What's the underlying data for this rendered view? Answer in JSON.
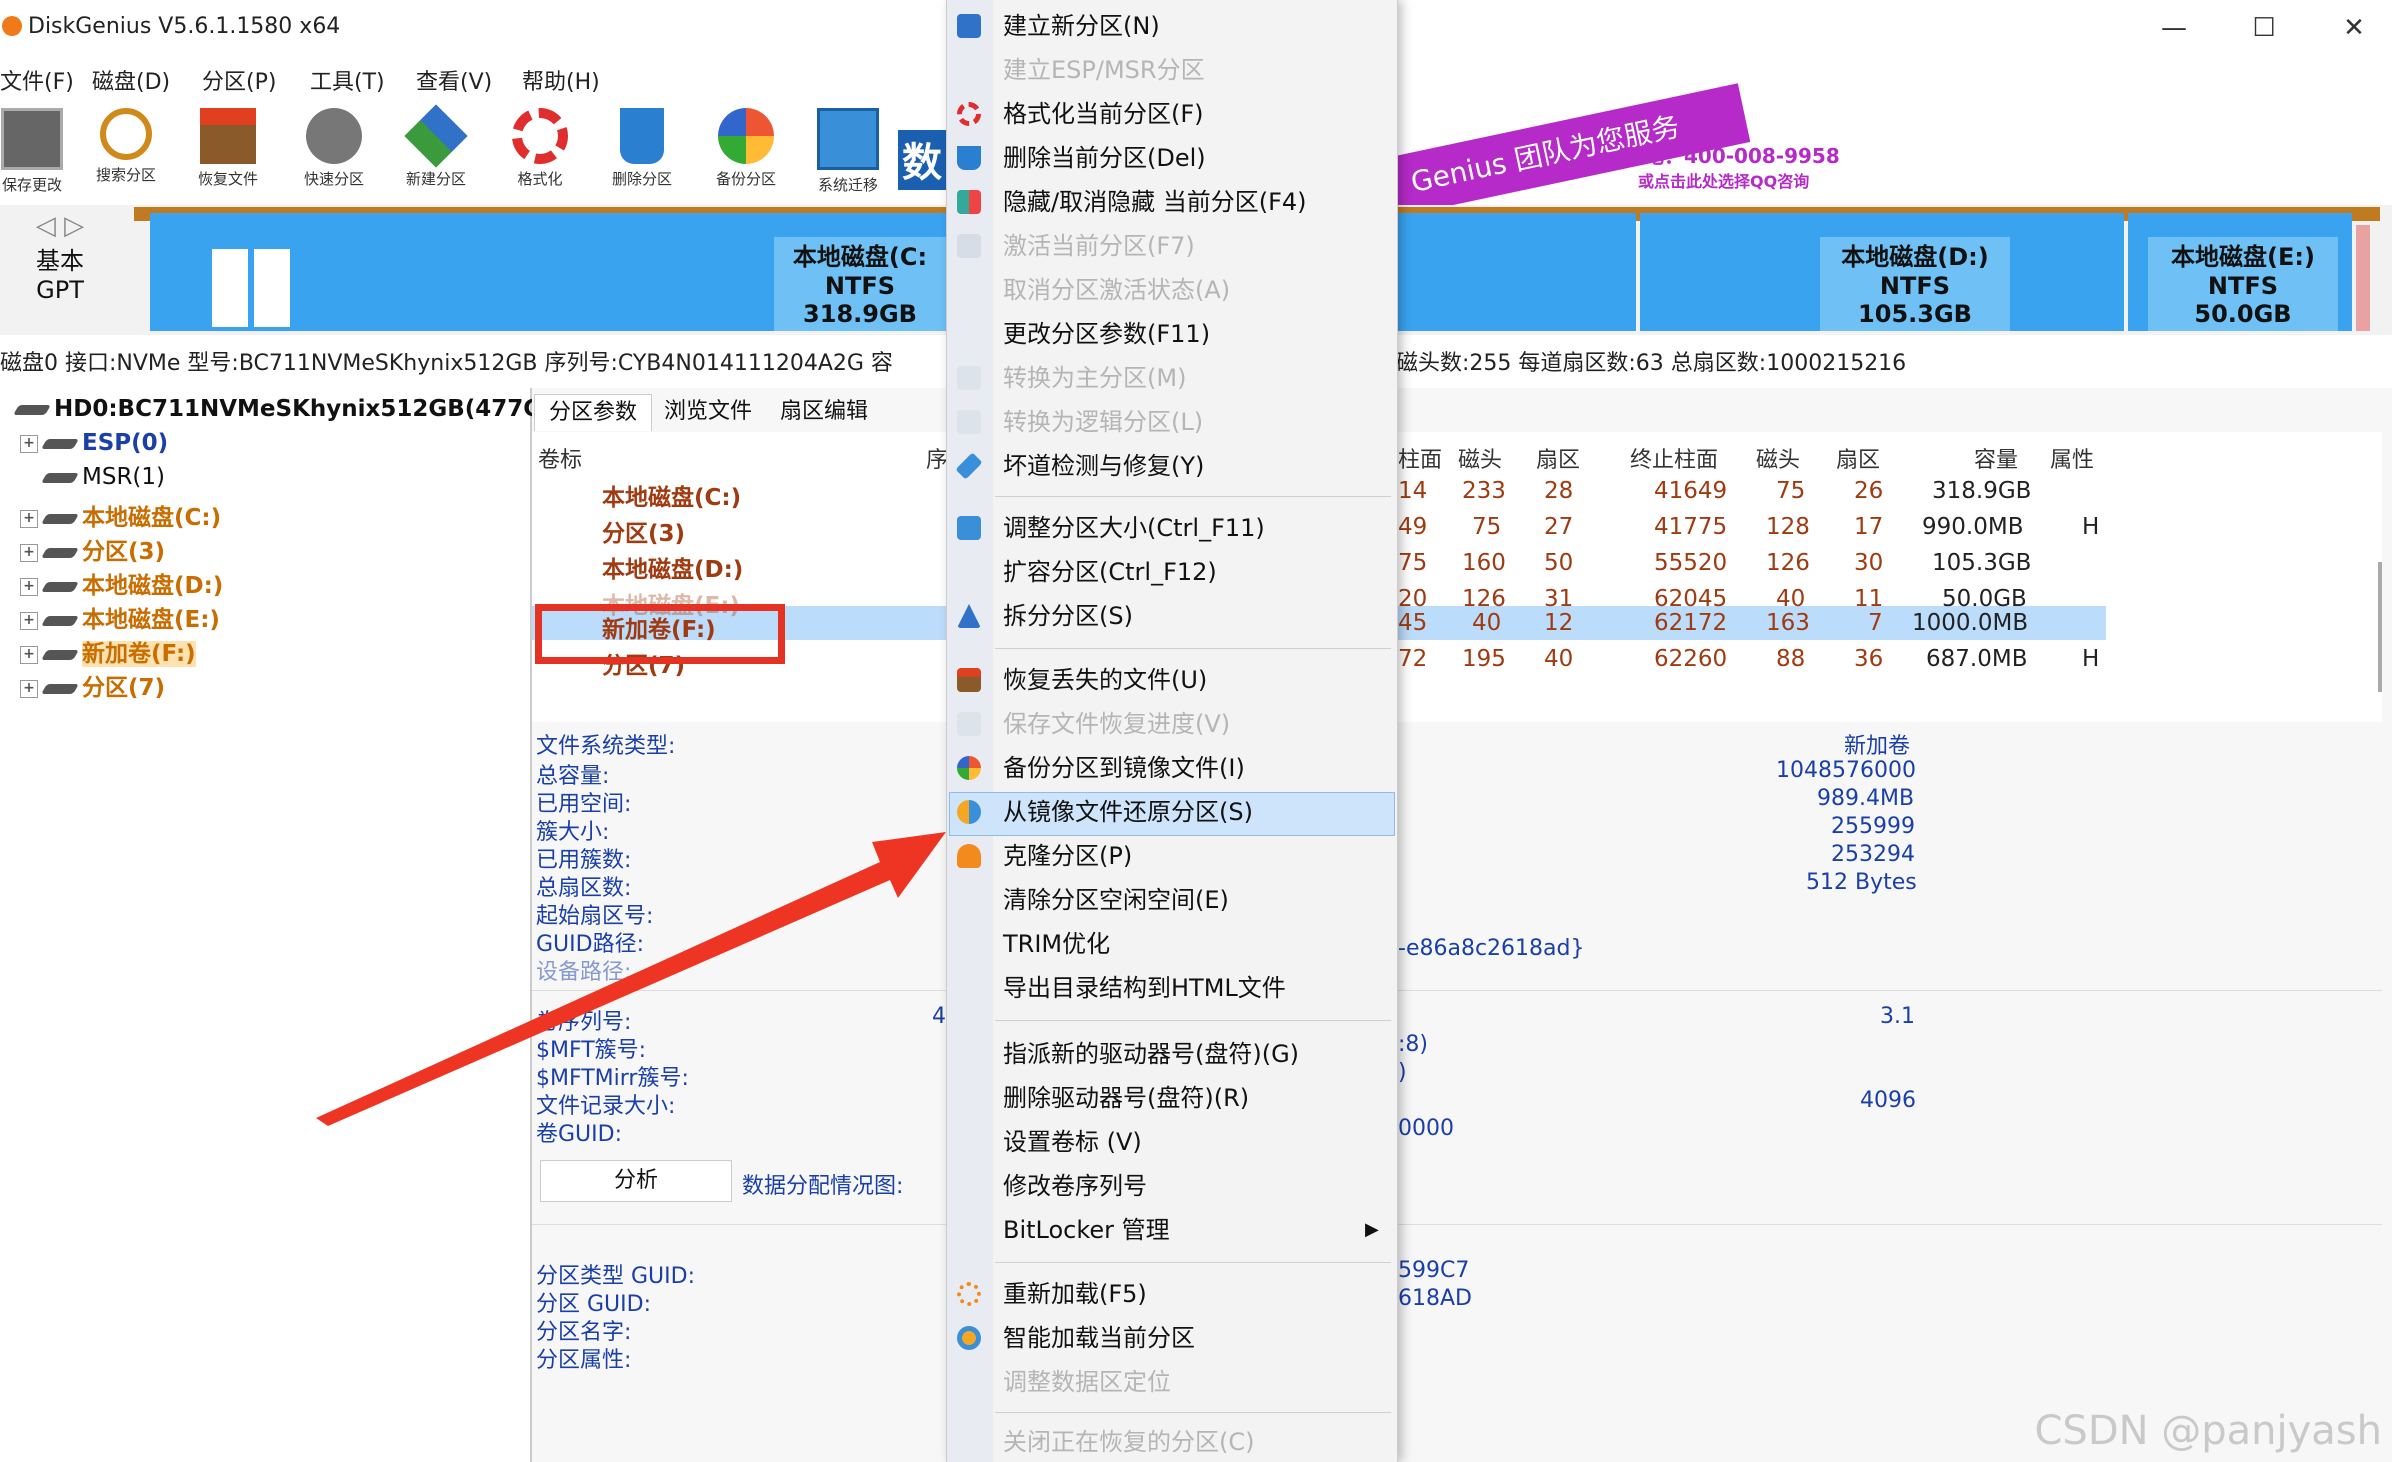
{
  "window": {
    "title": "DiskGenius V5.6.1.1580 x64",
    "minimize": "—",
    "maximize": "☐",
    "close": "✕"
  },
  "menubar": [
    "文件(F)",
    "磁盘(D)",
    "分区(P)",
    "工具(T)",
    "查看(V)",
    "帮助(H)"
  ],
  "toolbar": [
    {
      "label": "保存更改",
      "icon": "save-icon"
    },
    {
      "label": "搜索分区",
      "icon": "search-icon"
    },
    {
      "label": "恢复文件",
      "icon": "recover-icon"
    },
    {
      "label": "快速分区",
      "icon": "quick-partition-icon"
    },
    {
      "label": "新建分区",
      "icon": "new-partition-icon"
    },
    {
      "label": "格式化",
      "icon": "format-icon"
    },
    {
      "label": "删除分区",
      "icon": "delete-icon"
    },
    {
      "label": "备份分区",
      "icon": "backup-icon"
    },
    {
      "label": "系统迁移",
      "icon": "migrate-icon"
    }
  ],
  "banner": {
    "text1": "数",
    "slogan": "Genius 团队为您服务",
    "phone": "致电：400-008-9958",
    "qq": "或点击此处选择QQ咨询"
  },
  "disk_strip": {
    "type_line1": "基本",
    "type_line2": "GPT",
    "partitions": [
      {
        "name": "本地磁盘(C:",
        "fs": "NTFS",
        "size": "318.9GB"
      },
      {
        "name": "本地磁盘(D:)",
        "fs": "NTFS",
        "size": "105.3GB"
      },
      {
        "name": "本地磁盘(E:)",
        "fs": "NTFS",
        "size": "50.0GB"
      }
    ]
  },
  "info_line": {
    "left": "磁盘0 接口:NVMe  型号:BC711NVMeSKhynix512GB  序列号:CYB4N014111204A2G  容",
    "right": "磁头数:255  每道扇区数:63  总扇区数:1000215216"
  },
  "tree": {
    "root": "HD0:BC711NVMeSKhynix512GB(477GB",
    "items": [
      "ESP(0)",
      "MSR(1)",
      "本地磁盘(C:)",
      "分区(3)",
      "本地磁盘(D:)",
      "本地磁盘(E:)",
      "新加卷(F:)",
      "分区(7)"
    ]
  },
  "tabs": [
    "分区参数",
    "浏览文件",
    "扇区编辑"
  ],
  "table": {
    "col_label": "卷标",
    "col_seq": "序",
    "headers_right": [
      "柱面",
      "磁头",
      "扇区",
      "终止柱面",
      "磁头",
      "扇区",
      "容量",
      "属性"
    ],
    "rows": [
      {
        "label": "本地磁盘(C:)",
        "c1": "14",
        "h1": "233",
        "s1": "28",
        "ec": "41649",
        "h2": "75",
        "s2": "26",
        "cap": "318.9GB",
        "attr": ""
      },
      {
        "label": "分区(3)",
        "c1": "49",
        "h1": "75",
        "s1": "27",
        "ec": "41775",
        "h2": "128",
        "s2": "17",
        "cap": "990.0MB",
        "attr": "H"
      },
      {
        "label": "本地磁盘(D:)",
        "c1": "75",
        "h1": "160",
        "s1": "50",
        "ec": "55520",
        "h2": "126",
        "s2": "30",
        "cap": "105.3GB",
        "attr": ""
      },
      {
        "label": "本地磁盘(E:)",
        "c1": "20",
        "h1": "126",
        "s1": "31",
        "ec": "62045",
        "h2": "40",
        "s2": "11",
        "cap": "50.0GB",
        "attr": ""
      },
      {
        "label": "新加卷(F:)",
        "c1": "45",
        "h1": "40",
        "s1": "12",
        "ec": "62172",
        "h2": "163",
        "s2": "7",
        "cap": "1000.0MB",
        "attr": ""
      },
      {
        "label": "分区(7)",
        "c1": "72",
        "h1": "195",
        "s1": "40",
        "ec": "62260",
        "h2": "88",
        "s2": "36",
        "cap": "687.0MB",
        "attr": "H"
      }
    ]
  },
  "fs_info": {
    "fs_type_label": "文件系统类型:",
    "fs_type_value": "新加卷",
    "labels": [
      "总容量:",
      "已用空间:",
      "簇大小:",
      "已用簇数:",
      "总扇区数:",
      "起始扇区号:",
      "GUID路径:",
      "设备路径:"
    ],
    "values": [
      "1048576000",
      "989.4MB",
      "255999",
      "253294",
      "512 Bytes"
    ],
    "guid_path_tail": "-e86a8c2618ad}",
    "labels2": [
      "卷序列号:",
      "$MFT簇号:",
      "$MFTMirr簇号:",
      "文件记录大小:",
      "卷GUID:"
    ],
    "serial_fragment": "4",
    "ntfs_version": "3.1",
    "mft_fragment": ":8)",
    "mftmirr_fragment": ")",
    "record_size": "4096",
    "vol_guid_tail": "0000",
    "analyze_button": "分析",
    "alloc_label": "数据分配情况图:",
    "labels3": [
      "分区类型 GUID:",
      "分区 GUID:",
      "分区名字:",
      "分区属性:"
    ],
    "type_guid_tail": "599C7",
    "part_guid_tail": "618AD"
  },
  "context_menu": [
    {
      "label": "建立新分区(N)",
      "enabled": true,
      "icon": "new-partition-icon"
    },
    {
      "label": "建立ESP/MSR分区",
      "enabled": false
    },
    {
      "label": "格式化当前分区(F)",
      "enabled": true,
      "icon": "format-icon"
    },
    {
      "label": "删除当前分区(Del)",
      "enabled": true,
      "icon": "delete-icon"
    },
    {
      "label": "隐藏/取消隐藏 当前分区(F4)",
      "enabled": true,
      "icon": "hide-icon"
    },
    {
      "label": "激活当前分区(F7)",
      "enabled": false
    },
    {
      "label": "取消分区激活状态(A)",
      "enabled": false
    },
    {
      "label": "更改分区参数(F11)",
      "enabled": true
    },
    {
      "label": "转换为主分区(M)",
      "enabled": false
    },
    {
      "label": "转换为逻辑分区(L)",
      "enabled": false
    },
    {
      "label": "坏道检测与修复(Y)",
      "enabled": true,
      "icon": "repair-icon"
    },
    {
      "label": "调整分区大小(Ctrl_F11)",
      "enabled": true,
      "icon": "resize-icon"
    },
    {
      "label": "扩容分区(Ctrl_F12)",
      "enabled": true
    },
    {
      "label": "拆分分区(S)",
      "enabled": true,
      "icon": "split-icon"
    },
    {
      "label": "恢复丢失的文件(U)",
      "enabled": true,
      "icon": "recover-icon"
    },
    {
      "label": "保存文件恢复进度(V)",
      "enabled": false
    },
    {
      "label": "备份分区到镜像文件(I)",
      "enabled": true,
      "icon": "backup-icon"
    },
    {
      "label": "从镜像文件还原分区(S)",
      "enabled": true,
      "icon": "restore-icon"
    },
    {
      "label": "克隆分区(P)",
      "enabled": true,
      "icon": "clone-icon"
    },
    {
      "label": "清除分区空闲空间(E)",
      "enabled": true
    },
    {
      "label": "TRIM优化",
      "enabled": true
    },
    {
      "label": "导出目录结构到HTML文件",
      "enabled": true
    },
    {
      "label": "指派新的驱动器号(盘符)(G)",
      "enabled": true
    },
    {
      "label": "删除驱动器号(盘符)(R)",
      "enabled": true
    },
    {
      "label": "设置卷标 (V)",
      "enabled": true
    },
    {
      "label": "修改卷序列号",
      "enabled": true
    },
    {
      "label": "BitLocker 管理",
      "enabled": true,
      "submenu_arrow": "▶"
    },
    {
      "label": "重新加载(F5)",
      "enabled": true,
      "icon": "reload-icon"
    },
    {
      "label": "智能加载当前分区",
      "enabled": true,
      "icon": "smart-load-icon"
    },
    {
      "label": "调整数据区定位",
      "enabled": false
    },
    {
      "label": "关闭正在恢复的分区(C)",
      "enabled": false
    }
  ],
  "watermark": "CSDN @panjyash",
  "colors": {
    "accent": "#1a3fa8",
    "partition_blue": "#3aa3f0",
    "highlight": "#cde4fb",
    "annotation_red": "#e53323",
    "orange_text": "#c96d00"
  }
}
